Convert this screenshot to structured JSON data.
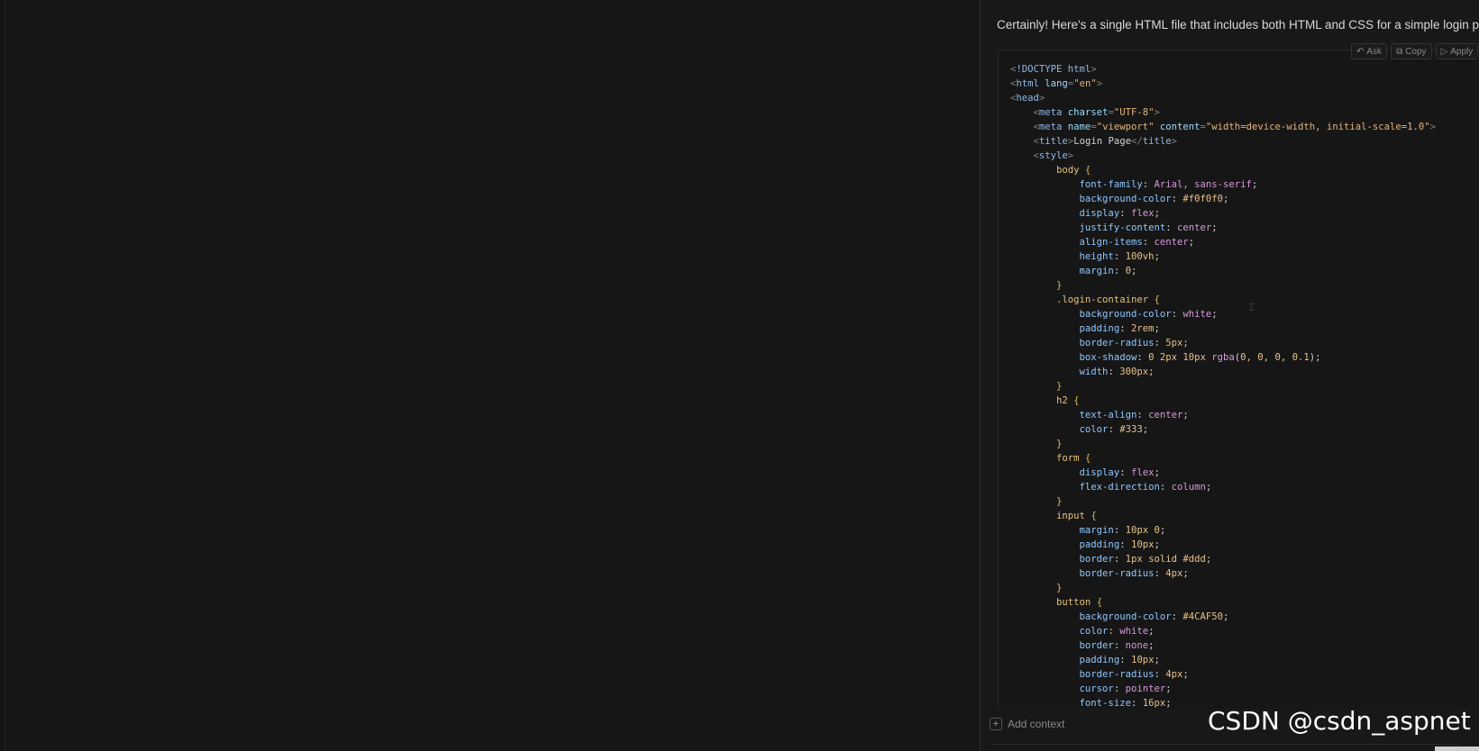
{
  "chat": {
    "intro": "Certainly! Here's a single HTML file that includes both HTML and CSS for a simple login page:",
    "actions": [
      {
        "icon": "reply-icon",
        "glyph": "↶",
        "label": "Ask"
      },
      {
        "icon": "copy-icon",
        "glyph": "⧉",
        "label": "Copy"
      },
      {
        "icon": "apply-icon",
        "glyph": "▷",
        "label": "Apply"
      }
    ],
    "code_lines": [
      [
        [
          "punc",
          "<"
        ],
        [
          "tag",
          "!DOCTYPE html"
        ],
        [
          "punc",
          ">"
        ]
      ],
      [
        [
          "punc",
          "<"
        ],
        [
          "tag",
          "html "
        ],
        [
          "attr",
          "lang"
        ],
        [
          "punc",
          "="
        ],
        [
          "str",
          "\"en\""
        ],
        [
          "punc",
          ">"
        ]
      ],
      [
        [
          "punc",
          "<"
        ],
        [
          "tag",
          "head"
        ],
        [
          "punc",
          ">"
        ]
      ],
      [
        [
          "text",
          "    "
        ],
        [
          "punc",
          "<"
        ],
        [
          "tag",
          "meta "
        ],
        [
          "attr",
          "charset"
        ],
        [
          "punc",
          "="
        ],
        [
          "str",
          "\"UTF-8\""
        ],
        [
          "punc",
          ">"
        ]
      ],
      [
        [
          "text",
          "    "
        ],
        [
          "punc",
          "<"
        ],
        [
          "tag",
          "meta "
        ],
        [
          "attr",
          "name"
        ],
        [
          "punc",
          "="
        ],
        [
          "str",
          "\"viewport\""
        ],
        [
          "text",
          " "
        ],
        [
          "attr",
          "content"
        ],
        [
          "punc",
          "="
        ],
        [
          "str",
          "\"width=device-width, initial-scale=1.0\""
        ],
        [
          "punc",
          ">"
        ]
      ],
      [
        [
          "text",
          "    "
        ],
        [
          "punc",
          "<"
        ],
        [
          "tag",
          "title"
        ],
        [
          "punc",
          ">"
        ],
        [
          "text",
          "Login Page"
        ],
        [
          "punc",
          "</"
        ],
        [
          "tag",
          "title"
        ],
        [
          "punc",
          ">"
        ]
      ],
      [
        [
          "text",
          "    "
        ],
        [
          "punc",
          "<"
        ],
        [
          "tag",
          "style"
        ],
        [
          "punc",
          ">"
        ]
      ],
      [
        [
          "text",
          "        "
        ],
        [
          "sel",
          "body "
        ],
        [
          "brace",
          "{"
        ]
      ],
      [
        [
          "text",
          "            "
        ],
        [
          "prop",
          "font-family"
        ],
        [
          "text",
          ": "
        ],
        [
          "val",
          "Arial, sans-serif"
        ],
        [
          "text",
          ";"
        ]
      ],
      [
        [
          "text",
          "            "
        ],
        [
          "prop",
          "background-color"
        ],
        [
          "text",
          ": "
        ],
        [
          "num",
          "#f0f0f0"
        ],
        [
          "text",
          ";"
        ]
      ],
      [
        [
          "text",
          "            "
        ],
        [
          "prop",
          "display"
        ],
        [
          "text",
          ": "
        ],
        [
          "val",
          "flex"
        ],
        [
          "text",
          ";"
        ]
      ],
      [
        [
          "text",
          "            "
        ],
        [
          "prop",
          "justify-content"
        ],
        [
          "text",
          ": "
        ],
        [
          "val",
          "center"
        ],
        [
          "text",
          ";"
        ]
      ],
      [
        [
          "text",
          "            "
        ],
        [
          "prop",
          "align-items"
        ],
        [
          "text",
          ": "
        ],
        [
          "val",
          "center"
        ],
        [
          "text",
          ";"
        ]
      ],
      [
        [
          "text",
          "            "
        ],
        [
          "prop",
          "height"
        ],
        [
          "text",
          ": "
        ],
        [
          "num",
          "100vh"
        ],
        [
          "text",
          ";"
        ]
      ],
      [
        [
          "text",
          "            "
        ],
        [
          "prop",
          "margin"
        ],
        [
          "text",
          ": "
        ],
        [
          "num",
          "0"
        ],
        [
          "text",
          ";"
        ]
      ],
      [
        [
          "text",
          "        "
        ],
        [
          "brace",
          "}"
        ]
      ],
      [
        [
          "text",
          "        "
        ],
        [
          "sel",
          ".login-container "
        ],
        [
          "brace",
          "{"
        ]
      ],
      [
        [
          "text",
          "            "
        ],
        [
          "prop",
          "background-color"
        ],
        [
          "text",
          ": "
        ],
        [
          "val",
          "white"
        ],
        [
          "text",
          ";"
        ]
      ],
      [
        [
          "text",
          "            "
        ],
        [
          "prop",
          "padding"
        ],
        [
          "text",
          ": "
        ],
        [
          "num",
          "2rem"
        ],
        [
          "text",
          ";"
        ]
      ],
      [
        [
          "text",
          "            "
        ],
        [
          "prop",
          "border-radius"
        ],
        [
          "text",
          ": "
        ],
        [
          "num",
          "5px"
        ],
        [
          "text",
          ";"
        ]
      ],
      [
        [
          "text",
          "            "
        ],
        [
          "prop",
          "box-shadow"
        ],
        [
          "text",
          ": "
        ],
        [
          "num",
          "0 2px 10px "
        ],
        [
          "val",
          "rgba"
        ],
        [
          "text",
          "("
        ],
        [
          "num",
          "0, 0, 0, 0.1"
        ],
        [
          "text",
          ");"
        ]
      ],
      [
        [
          "text",
          "            "
        ],
        [
          "prop",
          "width"
        ],
        [
          "text",
          ": "
        ],
        [
          "num",
          "300px"
        ],
        [
          "text",
          ";"
        ]
      ],
      [
        [
          "text",
          "        "
        ],
        [
          "brace",
          "}"
        ]
      ],
      [
        [
          "text",
          "        "
        ],
        [
          "sel",
          "h2 "
        ],
        [
          "brace",
          "{"
        ]
      ],
      [
        [
          "text",
          "            "
        ],
        [
          "prop",
          "text-align"
        ],
        [
          "text",
          ": "
        ],
        [
          "val",
          "center"
        ],
        [
          "text",
          ";"
        ]
      ],
      [
        [
          "text",
          "            "
        ],
        [
          "prop",
          "color"
        ],
        [
          "text",
          ": "
        ],
        [
          "num",
          "#333"
        ],
        [
          "text",
          ";"
        ]
      ],
      [
        [
          "text",
          "        "
        ],
        [
          "brace",
          "}"
        ]
      ],
      [
        [
          "text",
          "        "
        ],
        [
          "sel",
          "form "
        ],
        [
          "brace",
          "{"
        ]
      ],
      [
        [
          "text",
          "            "
        ],
        [
          "prop",
          "display"
        ],
        [
          "text",
          ": "
        ],
        [
          "val",
          "flex"
        ],
        [
          "text",
          ";"
        ]
      ],
      [
        [
          "text",
          "            "
        ],
        [
          "prop",
          "flex-direction"
        ],
        [
          "text",
          ": "
        ],
        [
          "val",
          "column"
        ],
        [
          "text",
          ";"
        ]
      ],
      [
        [
          "text",
          "        "
        ],
        [
          "brace",
          "}"
        ]
      ],
      [
        [
          "text",
          "        "
        ],
        [
          "sel",
          "input "
        ],
        [
          "brace",
          "{"
        ]
      ],
      [
        [
          "text",
          "            "
        ],
        [
          "prop",
          "margin"
        ],
        [
          "text",
          ": "
        ],
        [
          "num",
          "10px 0"
        ],
        [
          "text",
          ";"
        ]
      ],
      [
        [
          "text",
          "            "
        ],
        [
          "prop",
          "padding"
        ],
        [
          "text",
          ": "
        ],
        [
          "num",
          "10px"
        ],
        [
          "text",
          ";"
        ]
      ],
      [
        [
          "text",
          "            "
        ],
        [
          "prop",
          "border"
        ],
        [
          "text",
          ": "
        ],
        [
          "num",
          "1px solid #ddd"
        ],
        [
          "text",
          ";"
        ]
      ],
      [
        [
          "text",
          "            "
        ],
        [
          "prop",
          "border-radius"
        ],
        [
          "text",
          ": "
        ],
        [
          "num",
          "4px"
        ],
        [
          "text",
          ";"
        ]
      ],
      [
        [
          "text",
          "        "
        ],
        [
          "brace",
          "}"
        ]
      ],
      [
        [
          "text",
          "        "
        ],
        [
          "sel",
          "button "
        ],
        [
          "brace",
          "{"
        ]
      ],
      [
        [
          "text",
          "            "
        ],
        [
          "prop",
          "background-color"
        ],
        [
          "text",
          ": "
        ],
        [
          "num",
          "#4CAF50"
        ],
        [
          "text",
          ";"
        ]
      ],
      [
        [
          "text",
          "            "
        ],
        [
          "prop",
          "color"
        ],
        [
          "text",
          ": "
        ],
        [
          "val",
          "white"
        ],
        [
          "text",
          ";"
        ]
      ],
      [
        [
          "text",
          "            "
        ],
        [
          "prop",
          "border"
        ],
        [
          "text",
          ": "
        ],
        [
          "val",
          "none"
        ],
        [
          "text",
          ";"
        ]
      ],
      [
        [
          "text",
          "            "
        ],
        [
          "prop",
          "padding"
        ],
        [
          "text",
          ": "
        ],
        [
          "num",
          "10px"
        ],
        [
          "text",
          ";"
        ]
      ],
      [
        [
          "text",
          "            "
        ],
        [
          "prop",
          "border-radius"
        ],
        [
          "text",
          ": "
        ],
        [
          "num",
          "4px"
        ],
        [
          "text",
          ";"
        ]
      ],
      [
        [
          "text",
          "            "
        ],
        [
          "prop",
          "cursor"
        ],
        [
          "text",
          ": "
        ],
        [
          "val",
          "pointer"
        ],
        [
          "text",
          ";"
        ]
      ],
      [
        [
          "text",
          "            "
        ],
        [
          "prop",
          "font-size"
        ],
        [
          "text",
          ": "
        ],
        [
          "num",
          "16px"
        ],
        [
          "text",
          ";"
        ]
      ]
    ],
    "add_context": {
      "icon": "plus-icon",
      "glyph": "+",
      "label": "Add context"
    }
  },
  "watermark": "CSDN @csdn_aspnet",
  "colors": {
    "background": "#151515",
    "panel": "#181818",
    "tag": "#8fb8e8",
    "string": "#e5b57d",
    "property": "#8fc7ff",
    "value": "#d69ad8",
    "selector": "#e6c07b"
  }
}
